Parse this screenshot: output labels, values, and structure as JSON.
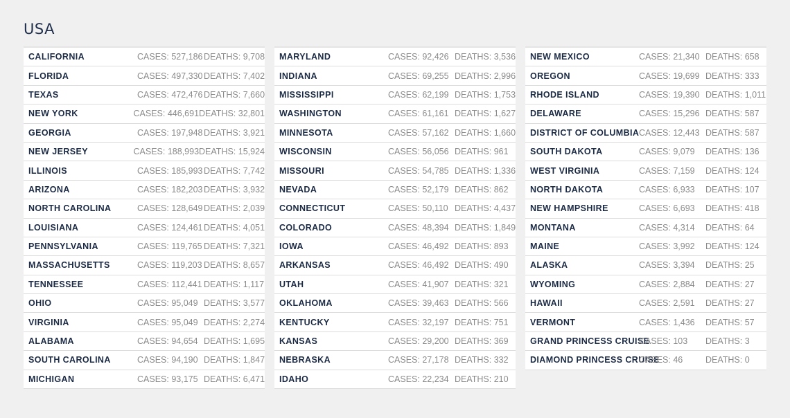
{
  "header": {
    "title": "USA"
  },
  "labels": {
    "cases_prefix": "CASES: ",
    "deaths_prefix": "DEATHS: "
  },
  "columns": [
    {
      "rows": [
        {
          "state": "CALIFORNIA",
          "cases": "527,186",
          "deaths": "9,708"
        },
        {
          "state": "FLORIDA",
          "cases": "497,330",
          "deaths": "7,402"
        },
        {
          "state": "TEXAS",
          "cases": "472,476",
          "deaths": "7,660"
        },
        {
          "state": "NEW YORK",
          "cases": "446,691",
          "deaths": "32,801"
        },
        {
          "state": "GEORGIA",
          "cases": "197,948",
          "deaths": "3,921"
        },
        {
          "state": "NEW JERSEY",
          "cases": "188,993",
          "deaths": "15,924"
        },
        {
          "state": "ILLINOIS",
          "cases": "185,993",
          "deaths": "7,742"
        },
        {
          "state": "ARIZONA",
          "cases": "182,203",
          "deaths": "3,932"
        },
        {
          "state": "NORTH CAROLINA",
          "cases": "128,649",
          "deaths": "2,039"
        },
        {
          "state": "LOUISIANA",
          "cases": "124,461",
          "deaths": "4,051"
        },
        {
          "state": "PENNSYLVANIA",
          "cases": "119,765",
          "deaths": "7,321"
        },
        {
          "state": "MASSACHUSETTS",
          "cases": "119,203",
          "deaths": "8,657"
        },
        {
          "state": "TENNESSEE",
          "cases": "112,441",
          "deaths": "1,117"
        },
        {
          "state": "OHIO",
          "cases": "95,049",
          "deaths": "3,577"
        },
        {
          "state": "VIRGINIA",
          "cases": "95,049",
          "deaths": "2,274"
        },
        {
          "state": "ALABAMA",
          "cases": "94,654",
          "deaths": "1,695"
        },
        {
          "state": "SOUTH CAROLINA",
          "cases": "94,190",
          "deaths": "1,847"
        },
        {
          "state": "MICHIGAN",
          "cases": "93,175",
          "deaths": "6,471"
        }
      ]
    },
    {
      "rows": [
        {
          "state": "MARYLAND",
          "cases": "92,426",
          "deaths": "3,536"
        },
        {
          "state": "INDIANA",
          "cases": "69,255",
          "deaths": "2,996"
        },
        {
          "state": "MISSISSIPPI",
          "cases": "62,199",
          "deaths": "1,753"
        },
        {
          "state": "WASHINGTON",
          "cases": "61,161",
          "deaths": "1,627"
        },
        {
          "state": "MINNESOTA",
          "cases": "57,162",
          "deaths": "1,660"
        },
        {
          "state": "WISCONSIN",
          "cases": "56,056",
          "deaths": "961"
        },
        {
          "state": "MISSOURI",
          "cases": "54,785",
          "deaths": "1,336"
        },
        {
          "state": "NEVADA",
          "cases": "52,179",
          "deaths": "862"
        },
        {
          "state": "CONNECTICUT",
          "cases": "50,110",
          "deaths": "4,437"
        },
        {
          "state": "COLORADO",
          "cases": "48,394",
          "deaths": "1,849"
        },
        {
          "state": "IOWA",
          "cases": "46,492",
          "deaths": "893"
        },
        {
          "state": "ARKANSAS",
          "cases": "46,492",
          "deaths": "490"
        },
        {
          "state": "UTAH",
          "cases": "41,907",
          "deaths": "321"
        },
        {
          "state": "OKLAHOMA",
          "cases": "39,463",
          "deaths": "566"
        },
        {
          "state": "KENTUCKY",
          "cases": "32,197",
          "deaths": "751"
        },
        {
          "state": "KANSAS",
          "cases": "29,200",
          "deaths": "369"
        },
        {
          "state": "NEBRASKA",
          "cases": "27,178",
          "deaths": "332"
        },
        {
          "state": "IDAHO",
          "cases": "22,234",
          "deaths": "210"
        }
      ]
    },
    {
      "rows": [
        {
          "state": "NEW MEXICO",
          "cases": "21,340",
          "deaths": "658"
        },
        {
          "state": "OREGON",
          "cases": "19,699",
          "deaths": "333"
        },
        {
          "state": "RHODE ISLAND",
          "cases": "19,390",
          "deaths": "1,011"
        },
        {
          "state": "DELAWARE",
          "cases": "15,296",
          "deaths": "587"
        },
        {
          "state": "DISTRICT OF COLUMBIA",
          "cases": "12,443",
          "deaths": "587"
        },
        {
          "state": "SOUTH DAKOTA",
          "cases": "9,079",
          "deaths": "136"
        },
        {
          "state": "WEST VIRGINIA",
          "cases": "7,159",
          "deaths": "124"
        },
        {
          "state": "NORTH DAKOTA",
          "cases": "6,933",
          "deaths": "107"
        },
        {
          "state": "NEW HAMPSHIRE",
          "cases": "6,693",
          "deaths": "418"
        },
        {
          "state": "MONTANA",
          "cases": "4,314",
          "deaths": "64"
        },
        {
          "state": "MAINE",
          "cases": "3,992",
          "deaths": "124"
        },
        {
          "state": "ALASKA",
          "cases": "3,394",
          "deaths": "25"
        },
        {
          "state": "WYOMING",
          "cases": "2,884",
          "deaths": "27"
        },
        {
          "state": "HAWAII",
          "cases": "2,591",
          "deaths": "27"
        },
        {
          "state": "VERMONT",
          "cases": "1,436",
          "deaths": "57"
        },
        {
          "state": "GRAND PRINCESS CRUISE",
          "cases": "103",
          "deaths": "3"
        },
        {
          "state": "DIAMOND PRINCESS CRUISE",
          "cases": "46",
          "deaths": "0"
        }
      ]
    }
  ],
  "colors": {
    "background": "#f0f0f0",
    "row_background": "#ffffff",
    "title": "#1f2e4a",
    "state_name": "#1c2b45",
    "stat_text": "#8a8a8a",
    "divider": "#dcdcdc"
  }
}
